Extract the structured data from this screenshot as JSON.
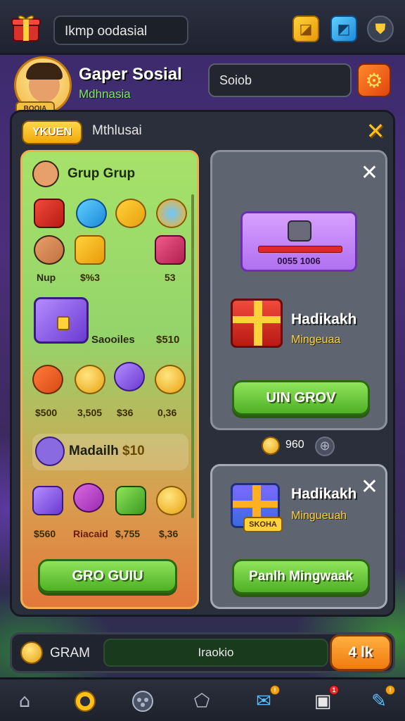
{
  "top_bar": {
    "search_value": "Ikmp oodasial"
  },
  "profile": {
    "name": "Gaper Sosial",
    "subtitle": "Mdhnasia",
    "badge": "BOOIA",
    "input_value": "Soiob"
  },
  "panel": {
    "tab_label": "YKUEN",
    "title": "Mthlusai"
  },
  "left_card": {
    "header": "Grup Grup",
    "row2_labels": [
      "Nup",
      "$%3",
      "53"
    ],
    "chest_label": "Saooiles",
    "chest_price": "$510",
    "row3_labels": [
      "$500",
      "3,505",
      "$36",
      "0,36"
    ],
    "section_title": "Madailh",
    "section_value": "$10",
    "row4_labels": [
      "$560",
      "Riacaid",
      "$,755",
      "$,36"
    ],
    "button": "GRO GUIU"
  },
  "right_card_top": {
    "banner_text": "0055 1006",
    "gift_title": "Hadikakh",
    "gift_subtitle": "Mingeuaa",
    "button": "UIN GROV"
  },
  "coins": {
    "value": "960"
  },
  "right_card_bottom": {
    "tag": "SKOHA",
    "gift_title": "Hadikakh",
    "gift_subtitle": "Mingueuah",
    "button": "Panlh Mingwaak"
  },
  "bottom_bar": {
    "label": "GRAM",
    "input_value": "Iraokio",
    "button": "4 lk"
  },
  "nav": {
    "items": [
      "home",
      "coin",
      "social",
      "house",
      "mail",
      "gift",
      "edit"
    ],
    "mail_badge": "!",
    "gift_badge": "1",
    "edit_badge": "!"
  },
  "colors": {
    "accent_gold": "#ffd23a",
    "button_green": "#4fb026",
    "button_orange": "#f07a10",
    "panel_bg": "#2a2f3b"
  }
}
